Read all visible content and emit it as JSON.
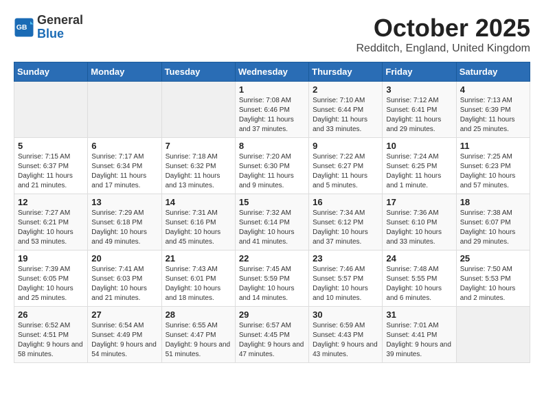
{
  "logo": {
    "general": "General",
    "blue": "Blue"
  },
  "header": {
    "month": "October 2025",
    "location": "Redditch, England, United Kingdom"
  },
  "weekdays": [
    "Sunday",
    "Monday",
    "Tuesday",
    "Wednesday",
    "Thursday",
    "Friday",
    "Saturday"
  ],
  "weeks": [
    [
      {
        "day": "",
        "sunrise": "",
        "sunset": "",
        "daylight": ""
      },
      {
        "day": "",
        "sunrise": "",
        "sunset": "",
        "daylight": ""
      },
      {
        "day": "",
        "sunrise": "",
        "sunset": "",
        "daylight": ""
      },
      {
        "day": "1",
        "sunrise": "Sunrise: 7:08 AM",
        "sunset": "Sunset: 6:46 PM",
        "daylight": "Daylight: 11 hours and 37 minutes."
      },
      {
        "day": "2",
        "sunrise": "Sunrise: 7:10 AM",
        "sunset": "Sunset: 6:44 PM",
        "daylight": "Daylight: 11 hours and 33 minutes."
      },
      {
        "day": "3",
        "sunrise": "Sunrise: 7:12 AM",
        "sunset": "Sunset: 6:41 PM",
        "daylight": "Daylight: 11 hours and 29 minutes."
      },
      {
        "day": "4",
        "sunrise": "Sunrise: 7:13 AM",
        "sunset": "Sunset: 6:39 PM",
        "daylight": "Daylight: 11 hours and 25 minutes."
      }
    ],
    [
      {
        "day": "5",
        "sunrise": "Sunrise: 7:15 AM",
        "sunset": "Sunset: 6:37 PM",
        "daylight": "Daylight: 11 hours and 21 minutes."
      },
      {
        "day": "6",
        "sunrise": "Sunrise: 7:17 AM",
        "sunset": "Sunset: 6:34 PM",
        "daylight": "Daylight: 11 hours and 17 minutes."
      },
      {
        "day": "7",
        "sunrise": "Sunrise: 7:18 AM",
        "sunset": "Sunset: 6:32 PM",
        "daylight": "Daylight: 11 hours and 13 minutes."
      },
      {
        "day": "8",
        "sunrise": "Sunrise: 7:20 AM",
        "sunset": "Sunset: 6:30 PM",
        "daylight": "Daylight: 11 hours and 9 minutes."
      },
      {
        "day": "9",
        "sunrise": "Sunrise: 7:22 AM",
        "sunset": "Sunset: 6:27 PM",
        "daylight": "Daylight: 11 hours and 5 minutes."
      },
      {
        "day": "10",
        "sunrise": "Sunrise: 7:24 AM",
        "sunset": "Sunset: 6:25 PM",
        "daylight": "Daylight: 11 hours and 1 minute."
      },
      {
        "day": "11",
        "sunrise": "Sunrise: 7:25 AM",
        "sunset": "Sunset: 6:23 PM",
        "daylight": "Daylight: 10 hours and 57 minutes."
      }
    ],
    [
      {
        "day": "12",
        "sunrise": "Sunrise: 7:27 AM",
        "sunset": "Sunset: 6:21 PM",
        "daylight": "Daylight: 10 hours and 53 minutes."
      },
      {
        "day": "13",
        "sunrise": "Sunrise: 7:29 AM",
        "sunset": "Sunset: 6:18 PM",
        "daylight": "Daylight: 10 hours and 49 minutes."
      },
      {
        "day": "14",
        "sunrise": "Sunrise: 7:31 AM",
        "sunset": "Sunset: 6:16 PM",
        "daylight": "Daylight: 10 hours and 45 minutes."
      },
      {
        "day": "15",
        "sunrise": "Sunrise: 7:32 AM",
        "sunset": "Sunset: 6:14 PM",
        "daylight": "Daylight: 10 hours and 41 minutes."
      },
      {
        "day": "16",
        "sunrise": "Sunrise: 7:34 AM",
        "sunset": "Sunset: 6:12 PM",
        "daylight": "Daylight: 10 hours and 37 minutes."
      },
      {
        "day": "17",
        "sunrise": "Sunrise: 7:36 AM",
        "sunset": "Sunset: 6:10 PM",
        "daylight": "Daylight: 10 hours and 33 minutes."
      },
      {
        "day": "18",
        "sunrise": "Sunrise: 7:38 AM",
        "sunset": "Sunset: 6:07 PM",
        "daylight": "Daylight: 10 hours and 29 minutes."
      }
    ],
    [
      {
        "day": "19",
        "sunrise": "Sunrise: 7:39 AM",
        "sunset": "Sunset: 6:05 PM",
        "daylight": "Daylight: 10 hours and 25 minutes."
      },
      {
        "day": "20",
        "sunrise": "Sunrise: 7:41 AM",
        "sunset": "Sunset: 6:03 PM",
        "daylight": "Daylight: 10 hours and 21 minutes."
      },
      {
        "day": "21",
        "sunrise": "Sunrise: 7:43 AM",
        "sunset": "Sunset: 6:01 PM",
        "daylight": "Daylight: 10 hours and 18 minutes."
      },
      {
        "day": "22",
        "sunrise": "Sunrise: 7:45 AM",
        "sunset": "Sunset: 5:59 PM",
        "daylight": "Daylight: 10 hours and 14 minutes."
      },
      {
        "day": "23",
        "sunrise": "Sunrise: 7:46 AM",
        "sunset": "Sunset: 5:57 PM",
        "daylight": "Daylight: 10 hours and 10 minutes."
      },
      {
        "day": "24",
        "sunrise": "Sunrise: 7:48 AM",
        "sunset": "Sunset: 5:55 PM",
        "daylight": "Daylight: 10 hours and 6 minutes."
      },
      {
        "day": "25",
        "sunrise": "Sunrise: 7:50 AM",
        "sunset": "Sunset: 5:53 PM",
        "daylight": "Daylight: 10 hours and 2 minutes."
      }
    ],
    [
      {
        "day": "26",
        "sunrise": "Sunrise: 6:52 AM",
        "sunset": "Sunset: 4:51 PM",
        "daylight": "Daylight: 9 hours and 58 minutes."
      },
      {
        "day": "27",
        "sunrise": "Sunrise: 6:54 AM",
        "sunset": "Sunset: 4:49 PM",
        "daylight": "Daylight: 9 hours and 54 minutes."
      },
      {
        "day": "28",
        "sunrise": "Sunrise: 6:55 AM",
        "sunset": "Sunset: 4:47 PM",
        "daylight": "Daylight: 9 hours and 51 minutes."
      },
      {
        "day": "29",
        "sunrise": "Sunrise: 6:57 AM",
        "sunset": "Sunset: 4:45 PM",
        "daylight": "Daylight: 9 hours and 47 minutes."
      },
      {
        "day": "30",
        "sunrise": "Sunrise: 6:59 AM",
        "sunset": "Sunset: 4:43 PM",
        "daylight": "Daylight: 9 hours and 43 minutes."
      },
      {
        "day": "31",
        "sunrise": "Sunrise: 7:01 AM",
        "sunset": "Sunset: 4:41 PM",
        "daylight": "Daylight: 9 hours and 39 minutes."
      },
      {
        "day": "",
        "sunrise": "",
        "sunset": "",
        "daylight": ""
      }
    ]
  ]
}
